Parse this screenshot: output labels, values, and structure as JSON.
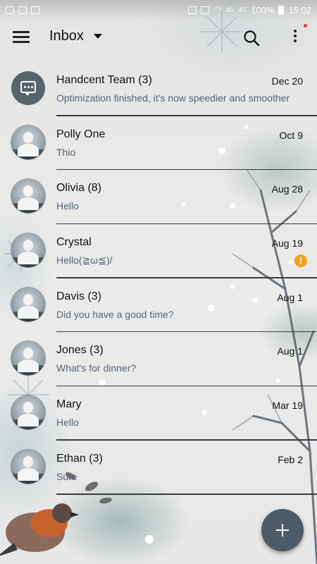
{
  "status_bar": {
    "network": "4G",
    "network2": "4G",
    "battery": "100%",
    "time": "15:02"
  },
  "header": {
    "title": "Inbox"
  },
  "conversations": [
    {
      "name": "Handcent Team (3)",
      "date": "Dec 20",
      "preview": "Optimization finished, it's now speedier and smoother",
      "avatar": "chat-bubble-icon"
    },
    {
      "name": "Polly One",
      "date": "Oct 9",
      "preview": "Thio",
      "avatar": "contact-avatar"
    },
    {
      "name": "Olivia (8)",
      "date": "Aug 28",
      "preview": "Hello",
      "avatar": "contact-avatar"
    },
    {
      "name": "Crystal",
      "date": "Aug 19",
      "preview": "Hello(≧ω≦)/",
      "avatar": "contact-avatar",
      "alert": "!"
    },
    {
      "name": "Davis (3)",
      "date": "Aug 1",
      "preview": "Did you have a good time?",
      "avatar": "contact-avatar"
    },
    {
      "name": "Jones (3)",
      "date": "Aug 1",
      "preview": "What's for dinner?",
      "avatar": "contact-avatar"
    },
    {
      "name": "Mary",
      "date": "Mar 19",
      "preview": "Hello",
      "avatar": "contact-avatar"
    },
    {
      "name": "Ethan (3)",
      "date": "Feb 2",
      "preview": "Sure",
      "avatar": "contact-avatar"
    }
  ],
  "colors": {
    "accent": "#4e5a66",
    "preview_text": "#566479",
    "alert": "#f3a31b"
  }
}
